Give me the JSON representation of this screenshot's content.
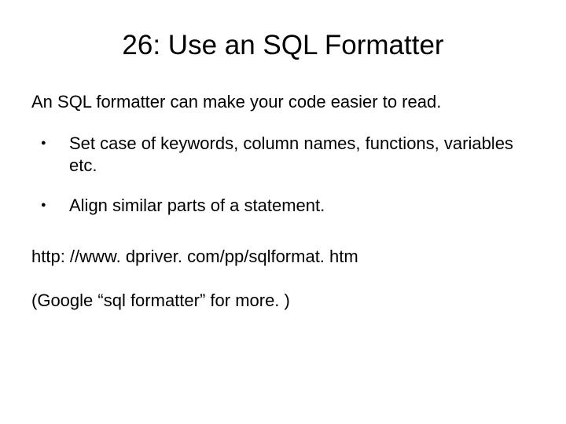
{
  "title": "26: Use an SQL Formatter",
  "intro": "An SQL formatter can make your code easier to read.",
  "bullets": [
    "Set case of keywords, column names, functions, variables etc.",
    "Align similar parts of a statement."
  ],
  "link": "http: //www. dpriver. com/pp/sqlformat. htm",
  "note": "(Google “sql formatter” for more. )"
}
